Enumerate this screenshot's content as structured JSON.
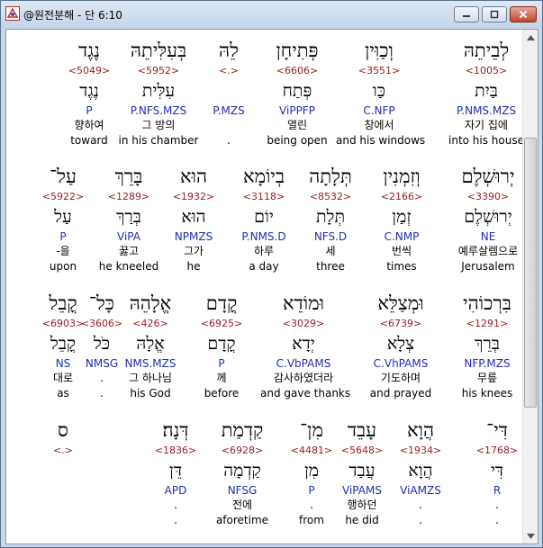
{
  "window": {
    "title": "@원전분해 - 단 6:10",
    "min_glyph": "▭",
    "max_glyph": "□",
    "close_glyph": "✕",
    "accent_close": "#c5442c",
    "icon": "app-logo-icon"
  },
  "colors": {
    "strong": "#9b1c1c",
    "morph": "#1d2fb3",
    "text": "#000000"
  },
  "rows": [
    {
      "words": [
        {
          "heb": "לְבֵיתֵהּ",
          "strong": "<1005>",
          "lemma": "בַּיִת",
          "morph": "P.NMS.MZS",
          "korean": "자기 집에",
          "english": "into his house"
        },
        {
          "heb": "וְכַוִּין",
          "strong": "<3551>",
          "lemma": "כַּו",
          "morph": "C.NFP",
          "korean": "창에서",
          "english": "and his windows"
        },
        {
          "heb": "פְּתִיחָן",
          "strong": "<6606>",
          "lemma": "פְּתַח",
          "morph": "ViPPFP",
          "korean": "열린",
          "english": "being open"
        },
        {
          "heb": "לֵהּ",
          "strong": "<.>",
          "lemma": "",
          "morph": "P.MZS",
          "korean": "",
          "english": "."
        },
        {
          "heb": "בְּעִלִּיתֵהּ",
          "strong": "<5952>",
          "lemma": "עִלִּית",
          "morph": "P.NFS.MZS",
          "korean": "그 방의",
          "english": "in his chamber"
        },
        {
          "heb": "נֶגֶד",
          "strong": "<5049>",
          "lemma": "נֶגֶד",
          "morph": "P",
          "korean": "향하여",
          "english": "toward"
        }
      ]
    },
    {
      "words": [
        {
          "heb": "יְרוּשְׁלֶם",
          "strong": "<3390>",
          "lemma": "יְרוּשְׁלֶם",
          "morph": "NE",
          "korean": "예루살렘으로",
          "english": "Jerusalem"
        },
        {
          "heb": "וְזִמְנִין",
          "strong": "<2166>",
          "lemma": "זְמַן",
          "morph": "C.NMP",
          "korean": "번씩",
          "english": "times"
        },
        {
          "heb": "תְּלָתָה",
          "strong": "<8532>",
          "lemma": "תְּלָת",
          "morph": "NFS.D",
          "korean": "세",
          "english": "three"
        },
        {
          "heb": "בְיוֹמָא",
          "strong": "<3118>",
          "lemma": "יוֹם",
          "morph": "P.NMS.D",
          "korean": "하루",
          "english": "a day"
        },
        {
          "heb": "הוּא",
          "strong": "<1932>",
          "lemma": "הוּא",
          "morph": "NPMZS",
          "korean": "그가",
          "english": "he"
        },
        {
          "heb": "בָּרֵךְ",
          "strong": "<1289>",
          "lemma": "בְּרַךְ",
          "morph": "ViPA",
          "korean": "꿇고",
          "english": "he kneeled"
        },
        {
          "heb": "עַל־",
          "strong": "<5922>",
          "lemma": "עַל",
          "morph": "P",
          "korean": "-을",
          "english": "upon"
        }
      ]
    },
    {
      "words": [
        {
          "heb": "בִּרְכוֹהִי",
          "strong": "<1291>",
          "lemma": "בְּרֵךְ",
          "morph": "NFP.MZS",
          "korean": "무릎",
          "english": "his knees"
        },
        {
          "heb": "וּמְצַלֵּא",
          "strong": "<6739>",
          "lemma": "צְלָא",
          "morph": "C.VhPAMS",
          "korean": "기도하며",
          "english": "and prayed"
        },
        {
          "heb": "וּמוֹדֵא",
          "strong": "<3029>",
          "lemma": "יְדָא",
          "morph": "C.VbPAMS",
          "korean": "감사하였더라",
          "english": "and gave thanks"
        },
        {
          "heb": "קֳדָם",
          "strong": "<6925>",
          "lemma": "קֳדָם",
          "morph": "P",
          "korean": "께",
          "english": "before"
        },
        {
          "heb": "אֱלָהֵהּ",
          "strong": "<426>",
          "lemma": "אֱלָהּ",
          "morph": "NMS.MZS",
          "korean": "그 하나님",
          "english": "his God"
        },
        {
          "heb": "כָּל־",
          "strong": "<3606>",
          "lemma": "כֹּל",
          "morph": "NMSG",
          "korean": ".",
          "english": "."
        },
        {
          "heb": "קֳבֵל",
          "strong": "<6903>",
          "lemma": "קֳבֵל",
          "morph": "NS",
          "korean": "대로",
          "english": "as"
        }
      ]
    },
    {
      "words": [
        {
          "heb": "דִּי־",
          "strong": "<1768>",
          "lemma": "דִּי",
          "morph": "R",
          "korean": ".",
          "english": "."
        },
        {
          "heb": "הֲוָא",
          "strong": "<1934>",
          "lemma": "הֲוָא",
          "morph": "ViAMZS",
          "korean": ".",
          "english": "."
        },
        {
          "heb": "עָבֵד",
          "strong": "<5648>",
          "lemma": "עֲבַד",
          "morph": "ViPAMS",
          "korean": "행하던",
          "english": "he did"
        },
        {
          "heb": "מִן־",
          "strong": "<4481>",
          "lemma": "מִן",
          "morph": "P",
          "korean": ".",
          "english": "from"
        },
        {
          "heb": "קַדְמַת",
          "strong": "<6928>",
          "lemma": "קַדְמָה",
          "morph": "NFSG",
          "korean": "전에",
          "english": "aforetime"
        },
        {
          "heb": "דְּנָה׃",
          "strong": "<1836>",
          "lemma": "דֵּן",
          "morph": "APD",
          "korean": ".",
          "english": "."
        },
        {
          "heb": "ס",
          "strong": "<.>",
          "lemma": "",
          "morph": "",
          "korean": "",
          "english": ""
        }
      ]
    }
  ]
}
